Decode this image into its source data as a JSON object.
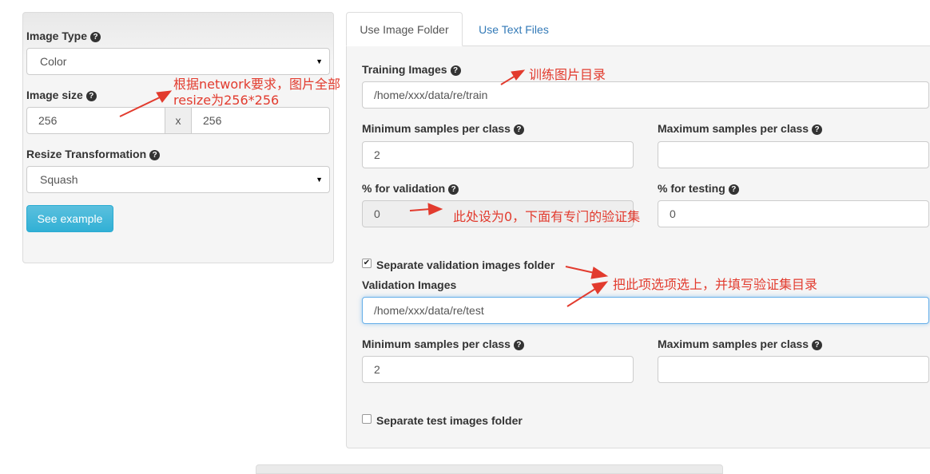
{
  "left_panel": {
    "image_type": {
      "label": "Image Type",
      "value": "Color"
    },
    "image_size": {
      "label": "Image size",
      "width": "256",
      "separator": "x",
      "height": "256"
    },
    "resize": {
      "label": "Resize Transformation",
      "value": "Squash"
    },
    "see_example_label": "See example"
  },
  "tabs": [
    {
      "label": "Use Image Folder",
      "active": true
    },
    {
      "label": "Use Text Files",
      "active": false
    }
  ],
  "form": {
    "training_images": {
      "label": "Training Images",
      "value": "/home/xxx/data/re/train"
    },
    "min_samples_1": {
      "label": "Minimum samples per class",
      "value": "2"
    },
    "max_samples_1": {
      "label": "Maximum samples per class",
      "value": ""
    },
    "pct_validation": {
      "label": "% for validation",
      "value": "0"
    },
    "pct_testing": {
      "label": "% for testing",
      "value": "0"
    },
    "separate_validation": {
      "label": "Separate validation images folder",
      "checked": true,
      "check_glyph": "✔"
    },
    "validation_images": {
      "label": "Validation Images",
      "value": "/home/xxx/data/re/test"
    },
    "min_samples_2": {
      "label": "Minimum samples per class",
      "value": "2"
    },
    "max_samples_2": {
      "label": "Maximum samples per class",
      "value": ""
    },
    "separate_test": {
      "label": "Separate test images folder",
      "checked": false
    }
  },
  "help_glyph": "?",
  "annotations": {
    "resize_note_line1": "根据network要求，图片全部",
    "resize_note_line2": "resize为256*256",
    "train_dir_note": "训练图片目录",
    "validation_note": "此处设为0，下面有专门的验证集",
    "separate_note": "把此项选项选上，并填写验证集目录"
  },
  "colors": {
    "annotation_red": "#e23b2e",
    "link_blue": "#337ab7",
    "button_info": "#5bc0de",
    "focus_blue": "#66afe9"
  }
}
